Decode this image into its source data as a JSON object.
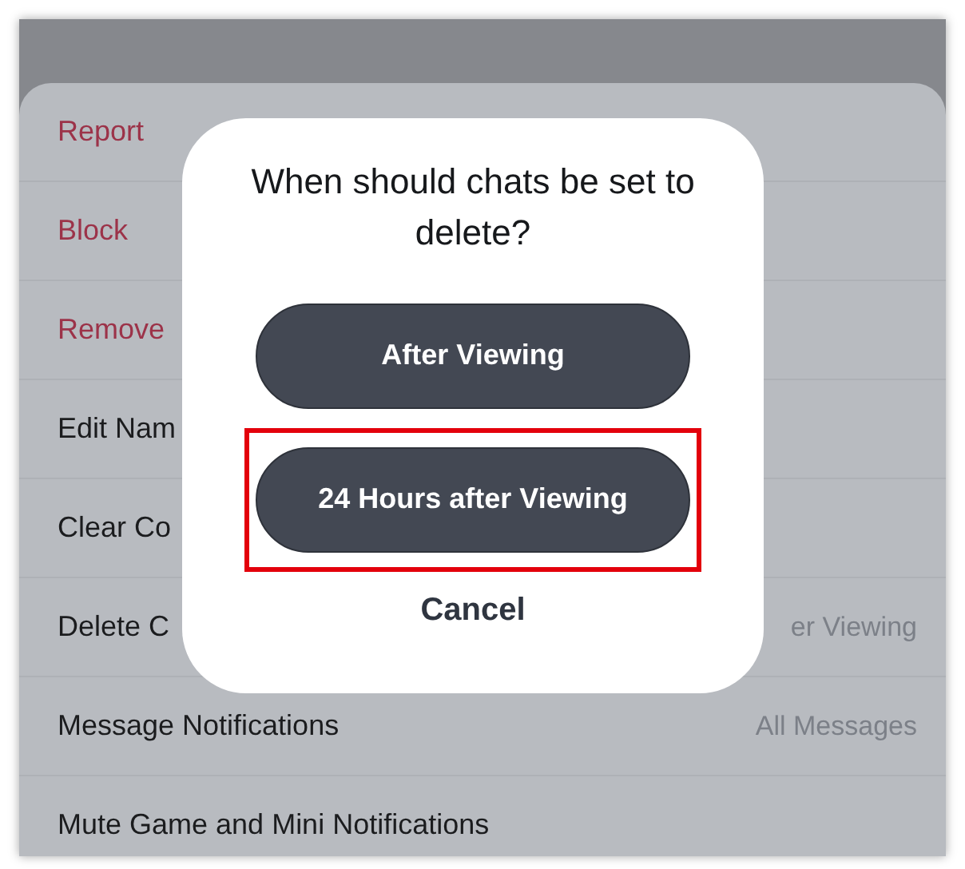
{
  "sheet": {
    "items": [
      {
        "label": "Report",
        "kind": "danger"
      },
      {
        "label": "Block",
        "kind": "danger"
      },
      {
        "label": "Remove",
        "kind": "danger"
      },
      {
        "label": "Edit Nam",
        "kind": "normal"
      },
      {
        "label": "Clear Co",
        "kind": "normal"
      },
      {
        "label": "Delete C",
        "kind": "normal",
        "value": "er Viewing"
      },
      {
        "label": "Message Notifications",
        "kind": "normal",
        "value": "All Messages"
      },
      {
        "label": "Mute Game and Mini Notifications",
        "kind": "normal"
      }
    ]
  },
  "dialog": {
    "title": "When should chats be set to delete?",
    "options": [
      {
        "label": "After Viewing",
        "highlighted": false
      },
      {
        "label": "24 Hours after Viewing",
        "highlighted": true
      }
    ],
    "cancel": "Cancel"
  }
}
